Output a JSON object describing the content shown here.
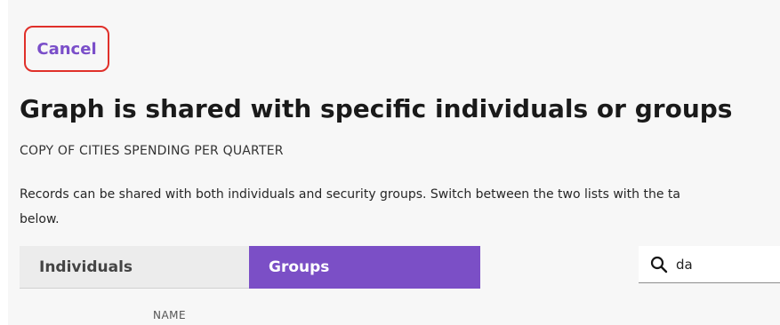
{
  "actions": {
    "cancel_label": "Cancel"
  },
  "header": {
    "title": "Graph is shared with specific individuals or groups",
    "subtitle": "COPY OF CITIES SPENDING PER QUARTER"
  },
  "description": {
    "line1": "Records can be shared with both individuals and security groups. Switch between the two lists with the ta",
    "line2": "below."
  },
  "tabs": [
    {
      "label": "Individuals",
      "selected": false
    },
    {
      "label": "Groups",
      "selected": true
    }
  ],
  "search": {
    "icon": "search-icon",
    "value": "da"
  },
  "table": {
    "columns": [
      "NAME"
    ]
  },
  "colors": {
    "accent": "#7b4fc6",
    "cancel_border": "#e0302a",
    "cancel_text": "#7a4ec9"
  }
}
